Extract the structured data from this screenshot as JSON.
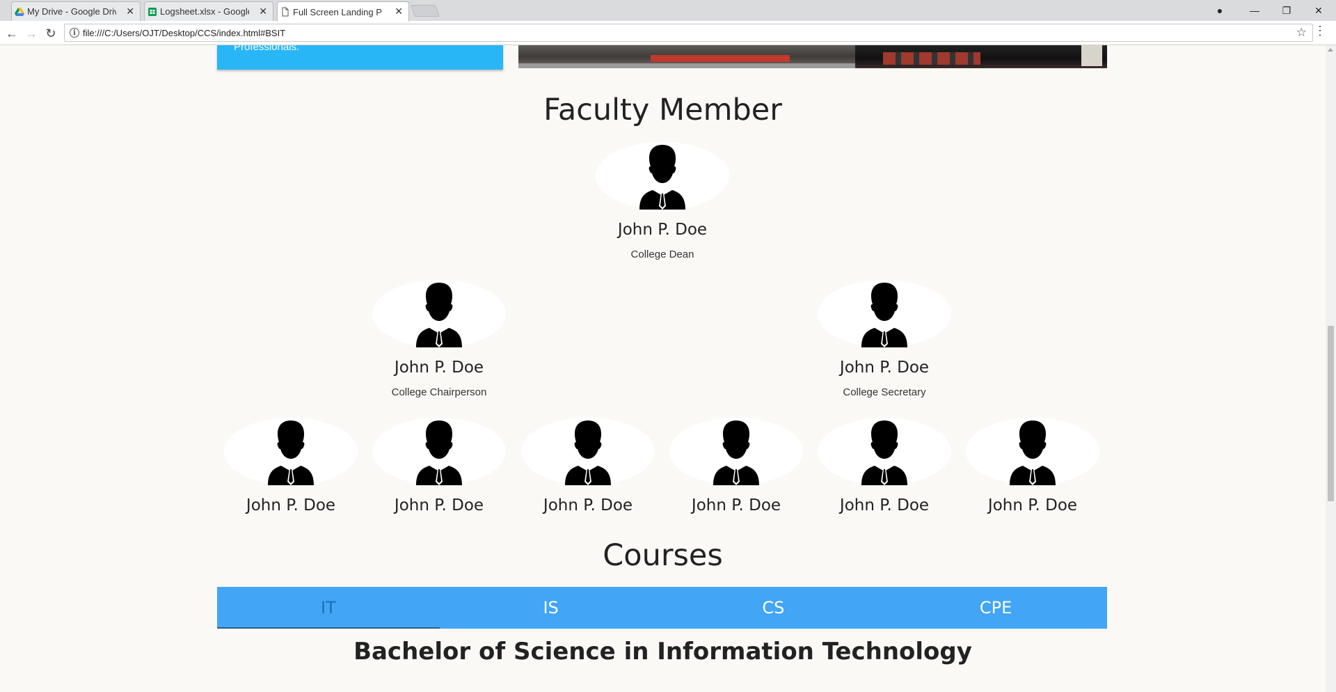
{
  "browser": {
    "tabs": [
      {
        "label": "My Drive - Google Drive",
        "icon": "google-drive-icon"
      },
      {
        "label": "Logsheet.xlsx - Google Sheets",
        "icon": "google-sheets-icon"
      },
      {
        "label": "Full Screen Landing Page",
        "icon": "page-icon"
      }
    ],
    "address": "file:///C:/Users/OJT/Desktop/CCS/index.html#BSIT",
    "controls": {
      "back": "←",
      "forward": "→",
      "reload": "↻",
      "star": "☆",
      "menu": "⋮",
      "minimize": "—",
      "restore": "❐",
      "close": "✕",
      "profile": "●"
    }
  },
  "page": {
    "hero_card_text": "Professionals.",
    "faculty": {
      "title": "Faculty Member",
      "dean": {
        "name": "John P. Doe",
        "role": "College Dean"
      },
      "chairperson": {
        "name": "John P. Doe",
        "role": "College Chairperson"
      },
      "secretary": {
        "name": "John P. Doe",
        "role": "College Secretary"
      },
      "members": [
        {
          "name": "John P. Doe"
        },
        {
          "name": "John P. Doe"
        },
        {
          "name": "John P. Doe"
        },
        {
          "name": "John P. Doe"
        },
        {
          "name": "John P. Doe"
        },
        {
          "name": "John P. Doe"
        }
      ]
    },
    "courses": {
      "title": "Courses",
      "tabs": [
        "IT",
        "IS",
        "CS",
        "CPE"
      ],
      "active_tab": "IT",
      "heading": "Bachelor of Science in Information Technology"
    }
  },
  "colors": {
    "accent_blue": "#42a5f5",
    "card_blue": "#29b6f6",
    "background": "#fbf9f6"
  }
}
